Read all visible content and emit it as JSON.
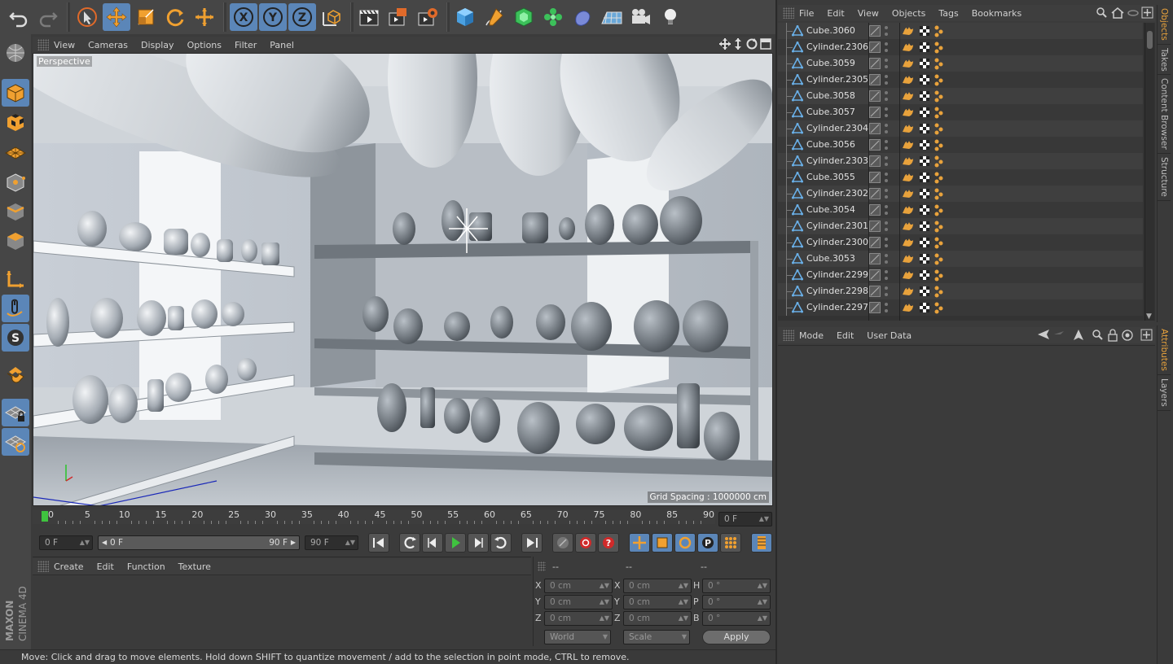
{
  "top_toolbar": {
    "icons": [
      "undo-icon",
      "redo-icon",
      "select-cursor-icon",
      "move-icon",
      "scale-icon",
      "rotate-icon",
      "live-selection-icon",
      "x-axis-icon",
      "y-axis-icon",
      "z-axis-icon",
      "coordinate-system-icon",
      "render-view-icon",
      "render-picture-viewer-icon",
      "render-settings-icon",
      "cube-object-icon",
      "pen-spline-icon",
      "subdivision-icon",
      "cloner-icon",
      "deformer-icon",
      "floor-icon",
      "camera-icon",
      "light-icon"
    ],
    "axis_labels": [
      "X",
      "Y",
      "Z"
    ]
  },
  "viewport": {
    "menu": [
      "View",
      "Cameras",
      "Display",
      "Options",
      "Filter",
      "Panel"
    ],
    "camera_label": "Perspective",
    "grid_spacing": "Grid Spacing : 1000000 cm"
  },
  "timeline": {
    "ticks": [
      "0",
      "5",
      "10",
      "15",
      "20",
      "25",
      "30",
      "35",
      "40",
      "45",
      "50",
      "55",
      "60",
      "65",
      "70",
      "75",
      "80",
      "85",
      "90"
    ],
    "current_frame": "0 F",
    "start_frame": "0 F",
    "range_start": "0 F",
    "range_end": "90 F",
    "end_frame": "90 F"
  },
  "material_manager": {
    "menu": [
      "Create",
      "Edit",
      "Function",
      "Texture"
    ]
  },
  "coordinates": {
    "headers": [
      "--",
      "--",
      "--"
    ],
    "rows": [
      {
        "pos_label": "X",
        "pos": "0 cm",
        "size_label": "X",
        "size": "0 cm",
        "rot_label": "H",
        "rot": "0 °"
      },
      {
        "pos_label": "Y",
        "pos": "0 cm",
        "size_label": "Y",
        "size": "0 cm",
        "rot_label": "P",
        "rot": "0 °"
      },
      {
        "pos_label": "Z",
        "pos": "0 cm",
        "size_label": "Z",
        "size": "0 cm",
        "rot_label": "B",
        "rot": "0 °"
      }
    ],
    "mode_select": "World",
    "size_select": "Scale",
    "apply_label": "Apply"
  },
  "object_manager": {
    "menu": [
      "File",
      "Edit",
      "View",
      "Objects",
      "Tags",
      "Bookmarks"
    ],
    "objects": [
      "Cube.3060",
      "Cylinder.2306",
      "Cube.3059",
      "Cylinder.2305",
      "Cube.3058",
      "Cube.3057",
      "Cylinder.2304",
      "Cube.3056",
      "Cylinder.2303",
      "Cube.3055",
      "Cylinder.2302",
      "Cube.3054",
      "Cylinder.2301",
      "Cylinder.2300",
      "Cube.3053",
      "Cylinder.2299",
      "Cylinder.2298",
      "Cylinder.2297"
    ]
  },
  "attribute_manager": {
    "menu": [
      "Mode",
      "Edit",
      "User Data"
    ]
  },
  "side_tabs_top": [
    "Objects",
    "Takes",
    "Content Browser",
    "Structure"
  ],
  "side_tabs_bottom": [
    "Attributes",
    "Layers"
  ],
  "brand": {
    "line1": "MAXON",
    "line2": "CINEMA 4D"
  },
  "status": "Move: Click and drag to move elements. Hold down SHIFT to quantize movement / add to the selection in point mode, CTRL to remove.",
  "colors": {
    "accent_blue": "#5b86b8",
    "orange": "#e8a23c",
    "play_green": "#3fc33f"
  }
}
